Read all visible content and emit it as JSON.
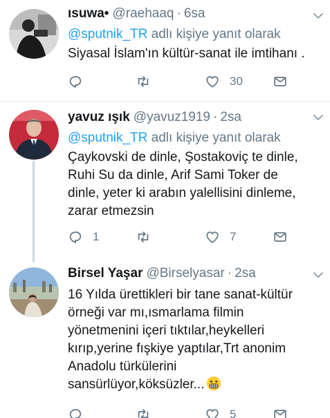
{
  "tweets": [
    {
      "name": "ısuwa•",
      "handle": "@raehaaq",
      "time": "6sa",
      "reply_prefix": "@sputnik_TR",
      "reply_suffix": " adlı kişiye yanıt olarak",
      "lines": [
        "Siyasal İslam'ın kültür-sanat ile imtihanı ."
      ],
      "counts": {
        "reply": "",
        "retweet": "",
        "like": "30"
      }
    },
    {
      "name": "yavuz ışık",
      "handle": "@yavuz1919",
      "time": "2sa",
      "reply_prefix": "@sputnik_TR",
      "reply_suffix": " adlı kişiye yanıt olarak",
      "lines": [
        "Çaykovski de dinle, Şostakoviç te dinle,",
        "Ruhi Su da dinle, Arif Sami Toker de",
        "dinle, yeter ki arabın yalellisini dinleme,",
        "zarar etmezsin"
      ],
      "counts": {
        "reply": "1",
        "retweet": "",
        "like": "7"
      }
    },
    {
      "name": "Birsel Yaşar",
      "handle": "@Birselyasar",
      "time": "2sa",
      "lines": [
        "16 Yılda ürettikleri bir tane sanat-kültür",
        "örneği var mı,ısmarlama filmin",
        "yönetmenini içeri tıktılar,heykelleri",
        "kırıp,yerine fışkiye yaptılar,Trt anonim",
        "Anadolu türkülerini",
        "sansürlüyor,köksüzler..."
      ],
      "emoji": "grimacing-face",
      "counts": {
        "reply": "",
        "retweet": "",
        "like": "5"
      }
    }
  ],
  "separator": "·",
  "colors": {
    "link": "#1da1f2",
    "muted": "#657786",
    "text": "#14171a",
    "line": "#ccd6dd"
  }
}
